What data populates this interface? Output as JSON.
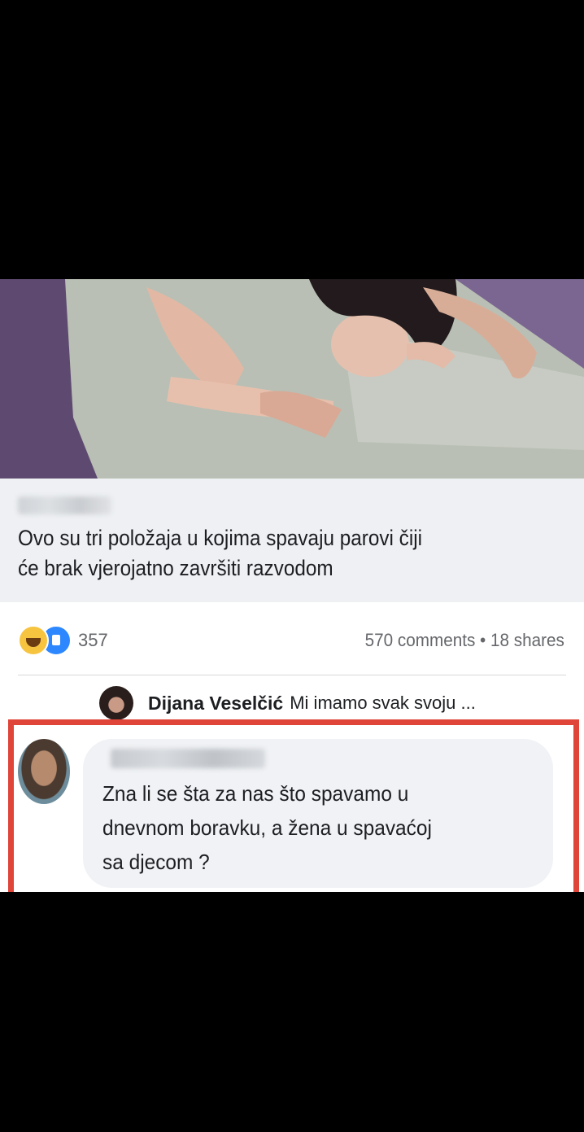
{
  "post": {
    "headline_lines": [
      "Ovo su tri položaja u kojima spavaju parovi čiji",
      "će brak vjerojatno završiti razvodom"
    ],
    "reaction_count": "357",
    "stats": "570 comments • 18 shares"
  },
  "preview_comment": {
    "author": "Dijana Veselčić",
    "text": "Mi imamo svak svoju ..."
  },
  "highlighted_comment": {
    "lines": [
      "Zna li se šta za nas što spavamo u",
      "dnevnom boravku, a žena u spavaćoj",
      "sa djecom ?"
    ]
  },
  "colors": {
    "highlight_border": "#e0453a",
    "reaction_like": "#2d88ff",
    "reaction_haha": "#f7c440",
    "bubble_bg": "#f0f2f5"
  },
  "icons": {
    "haha": "haha-reaction-icon",
    "like": "like-reaction-icon"
  }
}
